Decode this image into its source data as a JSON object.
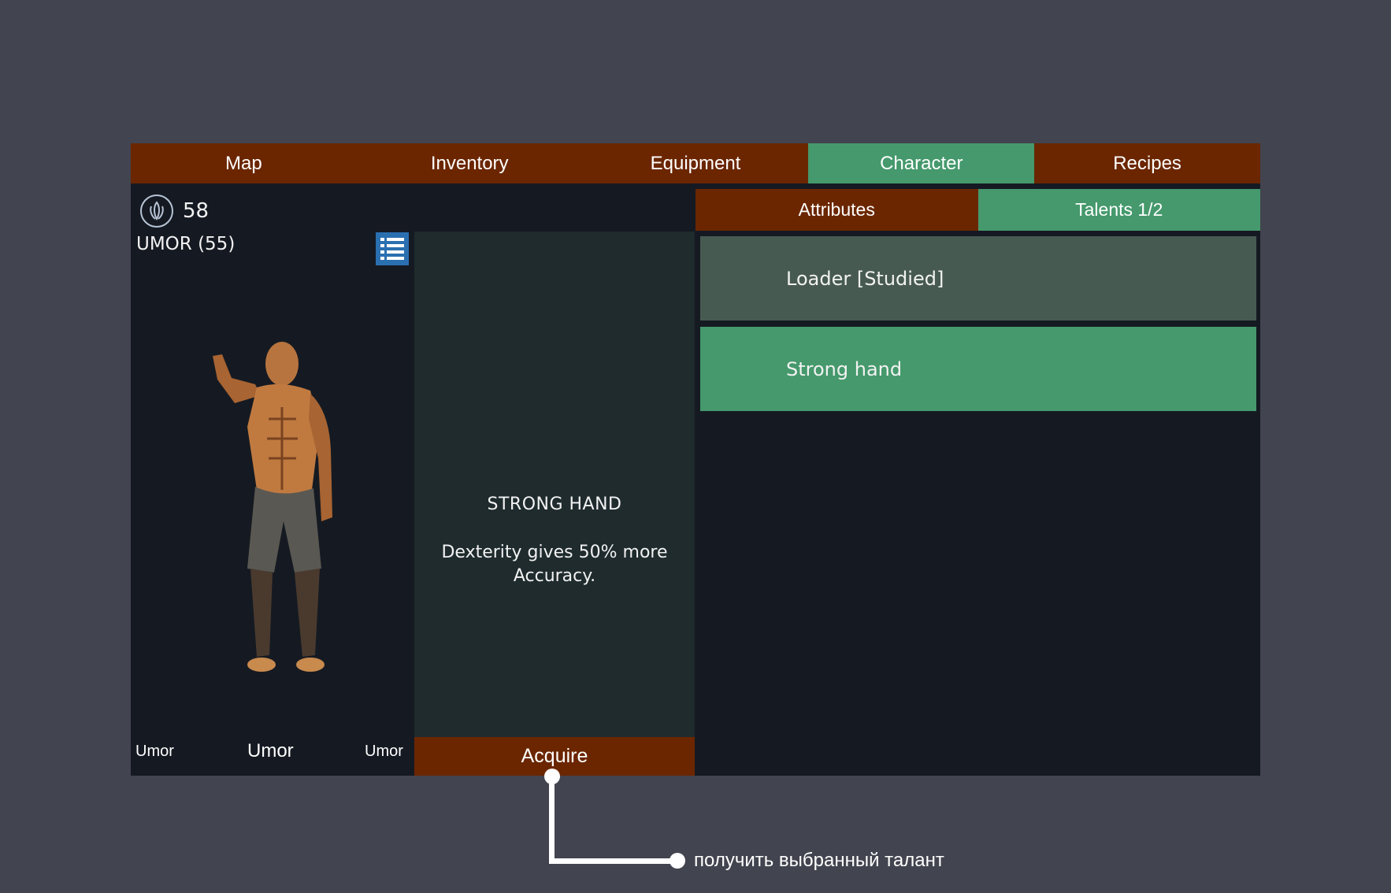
{
  "tabs": [
    {
      "label": "Map",
      "active": false
    },
    {
      "label": "Inventory",
      "active": false
    },
    {
      "label": "Equipment",
      "active": false
    },
    {
      "label": "Character",
      "active": true
    },
    {
      "label": "Recipes",
      "active": false
    }
  ],
  "character": {
    "currency_icon": "crystal-icon",
    "currency_value": "58",
    "name_level": "UMOR (55)",
    "list_icon": "list-icon",
    "bottom_left": "Umor",
    "bottom_center": "Umor",
    "bottom_right": "Umor"
  },
  "description": {
    "title": "STRONG HAND",
    "text": "Dexterity gives 50% more Accuracy.",
    "acquire_label": "Acquire"
  },
  "subtabs": [
    {
      "label": "Attributes",
      "active": false
    },
    {
      "label": "Talents 1/2",
      "active": true
    }
  ],
  "talents": [
    {
      "label": "Loader [Studied]",
      "state": "studied"
    },
    {
      "label": "Strong hand",
      "state": "selected"
    }
  ],
  "annotation": {
    "text": "получить выбранный талант"
  },
  "colors": {
    "tab_inactive": "#6b2600",
    "tab_active": "#45996c",
    "panel_bg": "#151a22",
    "desc_bg": "#1f2b2d",
    "talent_studied": "#475a52",
    "page_bg": "#42444f"
  }
}
